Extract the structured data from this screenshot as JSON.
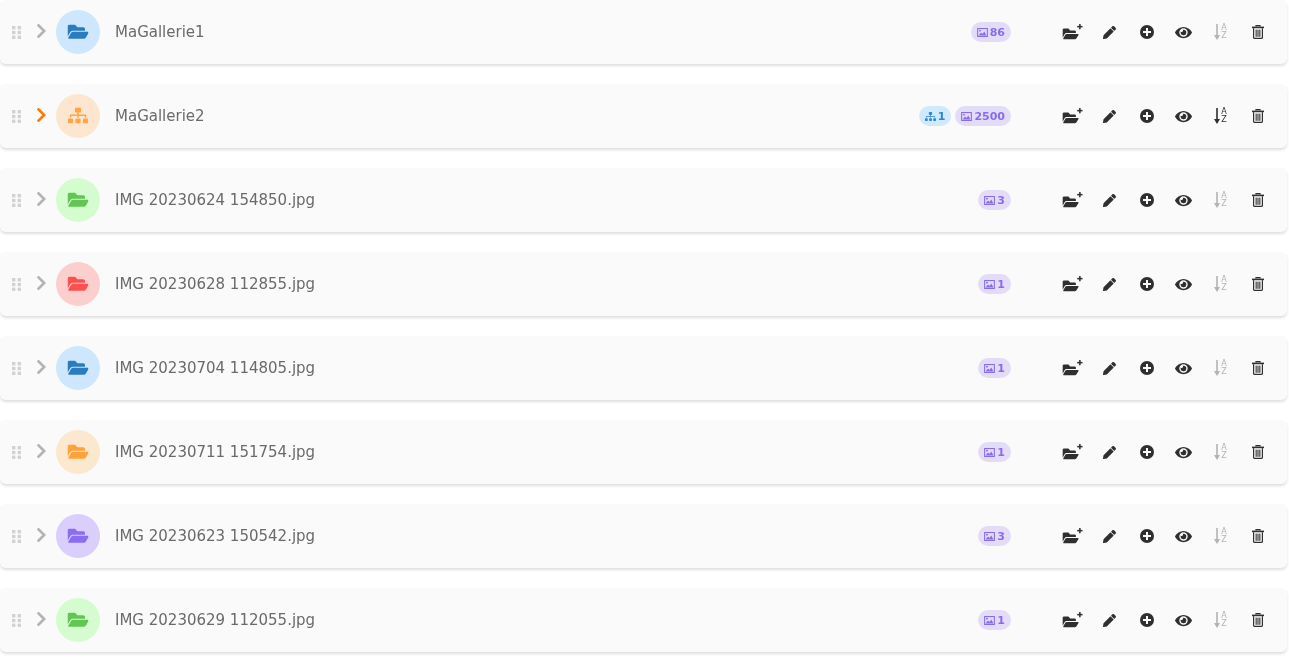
{
  "galleries": [
    {
      "name": "MaGallerie1",
      "kind": "folder",
      "color": "#2b7bbf",
      "expandable": false,
      "sort_enabled": false,
      "sort_letters": [
        "A",
        "Z"
      ],
      "badges": [
        {
          "kind": "images",
          "count": "86"
        }
      ]
    },
    {
      "name": "MaGallerie2",
      "kind": "hierarchy",
      "color": "#ffa447",
      "expandable": true,
      "sort_enabled": true,
      "sort_letters": [
        "A",
        "Z"
      ],
      "badges": [
        {
          "kind": "subgalleries",
          "count": "1"
        },
        {
          "kind": "images",
          "count": "2500"
        }
      ]
    },
    {
      "name": "IMG 20230624 154850.jpg",
      "kind": "folder",
      "color": "#62c554",
      "expandable": false,
      "sort_enabled": false,
      "sort_letters": [
        "A",
        "Z"
      ],
      "badges": [
        {
          "kind": "images",
          "count": "3"
        }
      ]
    },
    {
      "name": "IMG 20230628 112855.jpg",
      "kind": "folder",
      "color": "#ff4f4f",
      "expandable": false,
      "sort_enabled": false,
      "sort_letters": [
        "A",
        "Z"
      ],
      "badges": [
        {
          "kind": "images",
          "count": "1"
        }
      ]
    },
    {
      "name": "IMG 20230704 114805.jpg",
      "kind": "folder",
      "color": "#2b7bbf",
      "expandable": false,
      "sort_enabled": false,
      "sort_letters": [
        "A",
        "Z"
      ],
      "badges": [
        {
          "kind": "images",
          "count": "1"
        }
      ]
    },
    {
      "name": "IMG 20230711 151754.jpg",
      "kind": "folder",
      "color": "#ffa23a",
      "expandable": false,
      "sort_enabled": false,
      "sort_letters": [
        "A",
        "Z"
      ],
      "badges": [
        {
          "kind": "images",
          "count": "1"
        }
      ]
    },
    {
      "name": "IMG 20230623 150542.jpg",
      "kind": "folder",
      "color": "#8c6cf2",
      "expandable": false,
      "sort_enabled": false,
      "sort_letters": [
        "A",
        "Z"
      ],
      "badges": [
        {
          "kind": "images",
          "count": "3"
        }
      ]
    },
    {
      "name": "IMG 20230629 112055.jpg",
      "kind": "folder",
      "color": "#62c554",
      "expandable": false,
      "sort_enabled": false,
      "sort_letters": [
        "A",
        "Z"
      ],
      "badges": [
        {
          "kind": "images",
          "count": "1"
        }
      ]
    }
  ]
}
